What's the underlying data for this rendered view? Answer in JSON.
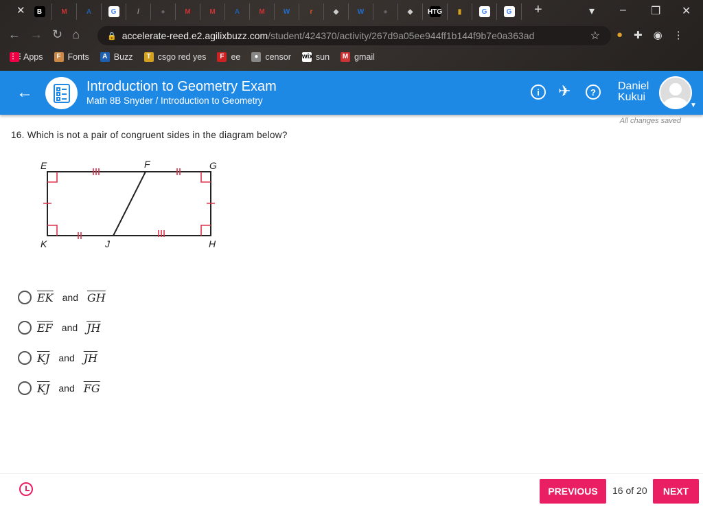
{
  "browser": {
    "tabs": [
      "B",
      "M",
      "A",
      "G",
      "/",
      "●",
      "M",
      "M",
      "A",
      "M",
      "W",
      "r",
      "◆",
      "W",
      "●",
      "◆",
      "HTG",
      "▮",
      "G",
      "G"
    ],
    "url_host": "accelerate-reed.e2.agilixbuzz.com",
    "url_path": "/student/424370/activity/267d9a05ee944ff1b144f9b7e0a363ad",
    "bookmarks": [
      {
        "icon": "⋮⋮",
        "label": "Apps"
      },
      {
        "icon": "F",
        "label": "Fonts"
      },
      {
        "icon": "A",
        "label": "Buzz"
      },
      {
        "icon": "T",
        "label": "csgo red yes"
      },
      {
        "icon": "F",
        "label": "ee"
      },
      {
        "icon": "●",
        "label": "censor"
      },
      {
        "icon": "wix",
        "label": "sun"
      },
      {
        "icon": "M",
        "label": "gmail"
      }
    ]
  },
  "header": {
    "title": "Introduction to Geometry Exam",
    "subtitle": "Math 8B Snyder / Introduction to Geometry",
    "user_first": "Daniel",
    "user_last": "Kukui",
    "info": "i",
    "help": "?"
  },
  "status": "All changes saved",
  "question": {
    "text": "16. Which is not a pair of congruent sides in the diagram below?",
    "labels": {
      "E": "E",
      "F": "F",
      "G": "G",
      "H": "H",
      "J": "J",
      "K": "K"
    },
    "options": [
      {
        "a": "EK",
        "b": "GH"
      },
      {
        "a": "EF",
        "b": "JH"
      },
      {
        "a": "KJ",
        "b": "JH"
      },
      {
        "a": "KJ",
        "b": "FG"
      }
    ],
    "and": "and"
  },
  "footer": {
    "previous": "PREVIOUS",
    "next": "NEXT",
    "progress": "16 of 20"
  },
  "colors": {
    "accent": "#e91e63",
    "header": "#1e88e5"
  }
}
